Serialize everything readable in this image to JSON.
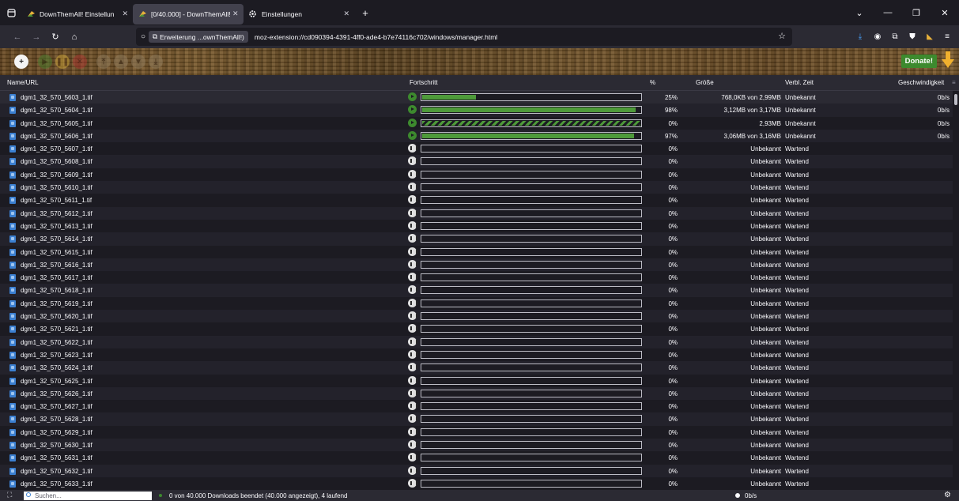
{
  "browser": {
    "tabs": [
      {
        "title": "DownThemAll! Einstellungen",
        "active": false,
        "icon": "dta-icon"
      },
      {
        "title": "[0/40.000] - DownThemAll! Ma",
        "active": true,
        "icon": "dta-icon"
      },
      {
        "title": "Einstellungen",
        "active": false,
        "icon": "gear-icon"
      }
    ],
    "new_tab": "+",
    "url_chip": "Erweiterung ...ownThemAll!)",
    "url": "moz-extension://cd090394-4391-4ff0-ade4-b7e74116c702/windows/manager.html"
  },
  "toolbar": {
    "donate_label": "Donate!"
  },
  "columns": {
    "name": "Name/URL",
    "progress": "Fortschritt",
    "percent": "%",
    "size": "Größe",
    "remaining": "Verbl. Zeit",
    "speed": "Geschwindigkeit"
  },
  "downloads": [
    {
      "name": "dgm1_32_570_5603_1.tif",
      "state": "running",
      "progress": 0.25,
      "percent": "25%",
      "size": "768,0KB von 2,99MB",
      "remaining": "Unbekannt",
      "speed": "0b/s"
    },
    {
      "name": "dgm1_32_570_5604_1.tif",
      "state": "running",
      "progress": 0.98,
      "percent": "98%",
      "size": "3,12MB von 3,17MB",
      "remaining": "Unbekannt",
      "speed": "0b/s"
    },
    {
      "name": "dgm1_32_570_5605_1.tif",
      "state": "running-indeterminate",
      "progress": 1.0,
      "percent": "0%",
      "size": "2,93MB",
      "remaining": "Unbekannt",
      "speed": "0b/s"
    },
    {
      "name": "dgm1_32_570_5606_1.tif",
      "state": "running",
      "progress": 0.97,
      "percent": "97%",
      "size": "3,06MB von 3,16MB",
      "remaining": "Unbekannt",
      "speed": "0b/s"
    },
    {
      "name": "dgm1_32_570_5607_1.tif",
      "state": "queued",
      "progress": 0,
      "percent": "0%",
      "size": "Unbekannt",
      "remaining": "Wartend",
      "speed": ""
    },
    {
      "name": "dgm1_32_570_5608_1.tif",
      "state": "queued",
      "progress": 0,
      "percent": "0%",
      "size": "Unbekannt",
      "remaining": "Wartend",
      "speed": ""
    },
    {
      "name": "dgm1_32_570_5609_1.tif",
      "state": "queued",
      "progress": 0,
      "percent": "0%",
      "size": "Unbekannt",
      "remaining": "Wartend",
      "speed": ""
    },
    {
      "name": "dgm1_32_570_5610_1.tif",
      "state": "queued",
      "progress": 0,
      "percent": "0%",
      "size": "Unbekannt",
      "remaining": "Wartend",
      "speed": ""
    },
    {
      "name": "dgm1_32_570_5611_1.tif",
      "state": "queued",
      "progress": 0,
      "percent": "0%",
      "size": "Unbekannt",
      "remaining": "Wartend",
      "speed": ""
    },
    {
      "name": "dgm1_32_570_5612_1.tif",
      "state": "queued",
      "progress": 0,
      "percent": "0%",
      "size": "Unbekannt",
      "remaining": "Wartend",
      "speed": ""
    },
    {
      "name": "dgm1_32_570_5613_1.tif",
      "state": "queued",
      "progress": 0,
      "percent": "0%",
      "size": "Unbekannt",
      "remaining": "Wartend",
      "speed": ""
    },
    {
      "name": "dgm1_32_570_5614_1.tif",
      "state": "queued",
      "progress": 0,
      "percent": "0%",
      "size": "Unbekannt",
      "remaining": "Wartend",
      "speed": ""
    },
    {
      "name": "dgm1_32_570_5615_1.tif",
      "state": "queued",
      "progress": 0,
      "percent": "0%",
      "size": "Unbekannt",
      "remaining": "Wartend",
      "speed": ""
    },
    {
      "name": "dgm1_32_570_5616_1.tif",
      "state": "queued",
      "progress": 0,
      "percent": "0%",
      "size": "Unbekannt",
      "remaining": "Wartend",
      "speed": ""
    },
    {
      "name": "dgm1_32_570_5617_1.tif",
      "state": "queued",
      "progress": 0,
      "percent": "0%",
      "size": "Unbekannt",
      "remaining": "Wartend",
      "speed": ""
    },
    {
      "name": "dgm1_32_570_5618_1.tif",
      "state": "queued",
      "progress": 0,
      "percent": "0%",
      "size": "Unbekannt",
      "remaining": "Wartend",
      "speed": ""
    },
    {
      "name": "dgm1_32_570_5619_1.tif",
      "state": "queued",
      "progress": 0,
      "percent": "0%",
      "size": "Unbekannt",
      "remaining": "Wartend",
      "speed": ""
    },
    {
      "name": "dgm1_32_570_5620_1.tif",
      "state": "queued",
      "progress": 0,
      "percent": "0%",
      "size": "Unbekannt",
      "remaining": "Wartend",
      "speed": ""
    },
    {
      "name": "dgm1_32_570_5621_1.tif",
      "state": "queued",
      "progress": 0,
      "percent": "0%",
      "size": "Unbekannt",
      "remaining": "Wartend",
      "speed": ""
    },
    {
      "name": "dgm1_32_570_5622_1.tif",
      "state": "queued",
      "progress": 0,
      "percent": "0%",
      "size": "Unbekannt",
      "remaining": "Wartend",
      "speed": ""
    },
    {
      "name": "dgm1_32_570_5623_1.tif",
      "state": "queued",
      "progress": 0,
      "percent": "0%",
      "size": "Unbekannt",
      "remaining": "Wartend",
      "speed": ""
    },
    {
      "name": "dgm1_32_570_5624_1.tif",
      "state": "queued",
      "progress": 0,
      "percent": "0%",
      "size": "Unbekannt",
      "remaining": "Wartend",
      "speed": ""
    },
    {
      "name": "dgm1_32_570_5625_1.tif",
      "state": "queued",
      "progress": 0,
      "percent": "0%",
      "size": "Unbekannt",
      "remaining": "Wartend",
      "speed": ""
    },
    {
      "name": "dgm1_32_570_5626_1.tif",
      "state": "queued",
      "progress": 0,
      "percent": "0%",
      "size": "Unbekannt",
      "remaining": "Wartend",
      "speed": ""
    },
    {
      "name": "dgm1_32_570_5627_1.tif",
      "state": "queued",
      "progress": 0,
      "percent": "0%",
      "size": "Unbekannt",
      "remaining": "Wartend",
      "speed": ""
    },
    {
      "name": "dgm1_32_570_5628_1.tif",
      "state": "queued",
      "progress": 0,
      "percent": "0%",
      "size": "Unbekannt",
      "remaining": "Wartend",
      "speed": ""
    },
    {
      "name": "dgm1_32_570_5629_1.tif",
      "state": "queued",
      "progress": 0,
      "percent": "0%",
      "size": "Unbekannt",
      "remaining": "Wartend",
      "speed": ""
    },
    {
      "name": "dgm1_32_570_5630_1.tif",
      "state": "queued",
      "progress": 0,
      "percent": "0%",
      "size": "Unbekannt",
      "remaining": "Wartend",
      "speed": ""
    },
    {
      "name": "dgm1_32_570_5631_1.tif",
      "state": "queued",
      "progress": 0,
      "percent": "0%",
      "size": "Unbekannt",
      "remaining": "Wartend",
      "speed": ""
    },
    {
      "name": "dgm1_32_570_5632_1.tif",
      "state": "queued",
      "progress": 0,
      "percent": "0%",
      "size": "Unbekannt",
      "remaining": "Wartend",
      "speed": ""
    },
    {
      "name": "dgm1_32_570_5633_1.tif",
      "state": "queued",
      "progress": 0,
      "percent": "0%",
      "size": "Unbekannt",
      "remaining": "Wartend",
      "speed": ""
    }
  ],
  "status": {
    "search_placeholder": "Suchen...",
    "summary": "0 von 40.000 Downloads beendet (40.000 angezeigt), 4 laufend",
    "speed": "0b/s"
  },
  "colors": {
    "progress_green": "#4e9a3a",
    "donate_green": "#3d8a2e",
    "background": "#1c1b22"
  }
}
